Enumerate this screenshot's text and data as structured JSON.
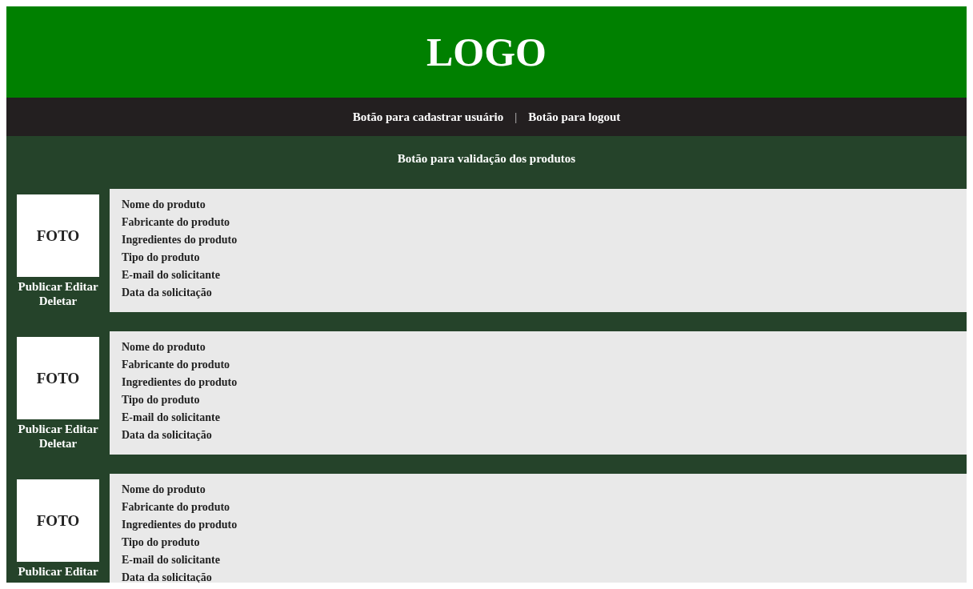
{
  "header": {
    "logo": "LOGO"
  },
  "nav": {
    "links": [
      "Botão para cadastrar usuário",
      "Botão para logout"
    ],
    "separator": "|"
  },
  "validation_button": "Botão para validação dos produtos",
  "products": [
    {
      "photo": "FOTO",
      "actions": [
        "Publicar",
        "Editar",
        "Deletar"
      ],
      "fields": [
        "Nome do produto",
        "Fabricante do produto",
        "Ingredientes do produto",
        "Tipo do produto",
        "E-mail do solicitante",
        "Data da solicitação"
      ]
    },
    {
      "photo": "FOTO",
      "actions": [
        "Publicar",
        "Editar",
        "Deletar"
      ],
      "fields": [
        "Nome do produto",
        "Fabricante do produto",
        "Ingredientes do produto",
        "Tipo do produto",
        "E-mail do solicitante",
        "Data da solicitação"
      ]
    },
    {
      "photo": "FOTO",
      "actions": [
        "Publicar",
        "Editar"
      ],
      "fields": [
        "Nome do produto",
        "Fabricante do produto",
        "Ingredientes do produto",
        "Tipo do produto",
        "E-mail do solicitante",
        "Data da solicitação"
      ]
    }
  ]
}
